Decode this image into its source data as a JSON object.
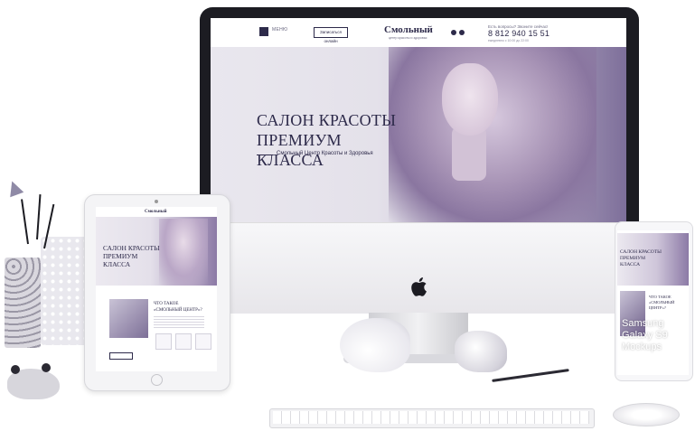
{
  "desktop_site": {
    "menu_label": "МЕНЮ",
    "signup_label": "Записаться онлайн",
    "logo_text": "Смольный",
    "logo_sub": "центр красоты и здоровья",
    "contact_question": "Есть вопросы? Звоните сейчас!",
    "phone": "8 812 940 15 51",
    "hours": "ежедневно с 10:00 до 22:00",
    "hero_title": "САЛОН КРАСОТЫ ПРЕМИУМ КЛАССА",
    "hero_subtitle": "Смольный Центр Красоты и Здоровья"
  },
  "tablet_site": {
    "logo_text": "Смольный",
    "hero_title": "САЛОН КРАСОТЫ ПРЕМИУМ КЛАССА",
    "section_title": "ЧТО ТАКОЕ «СМОЛЬНЫЙ ЦЕНТР»?"
  },
  "phone_site": {
    "hero_title": "САЛОН КРАСОТЫ ПРЕМИУМ КЛАССА",
    "section_title": "ЧТО ТАКОЕ «СМОЛЬНЫЙ ЦЕНТР»?",
    "mockup_watermark": "Samsung Galaxy S9 Mockups"
  },
  "colors": {
    "brand_dark": "#2d2a4a",
    "accent_purple": "#8c7aa6",
    "background": "#ffffff"
  },
  "icons": [
    "apple-icon",
    "menu-icon",
    "social-icon",
    "panda-figurine-icon",
    "bird-figurine-icon"
  ]
}
